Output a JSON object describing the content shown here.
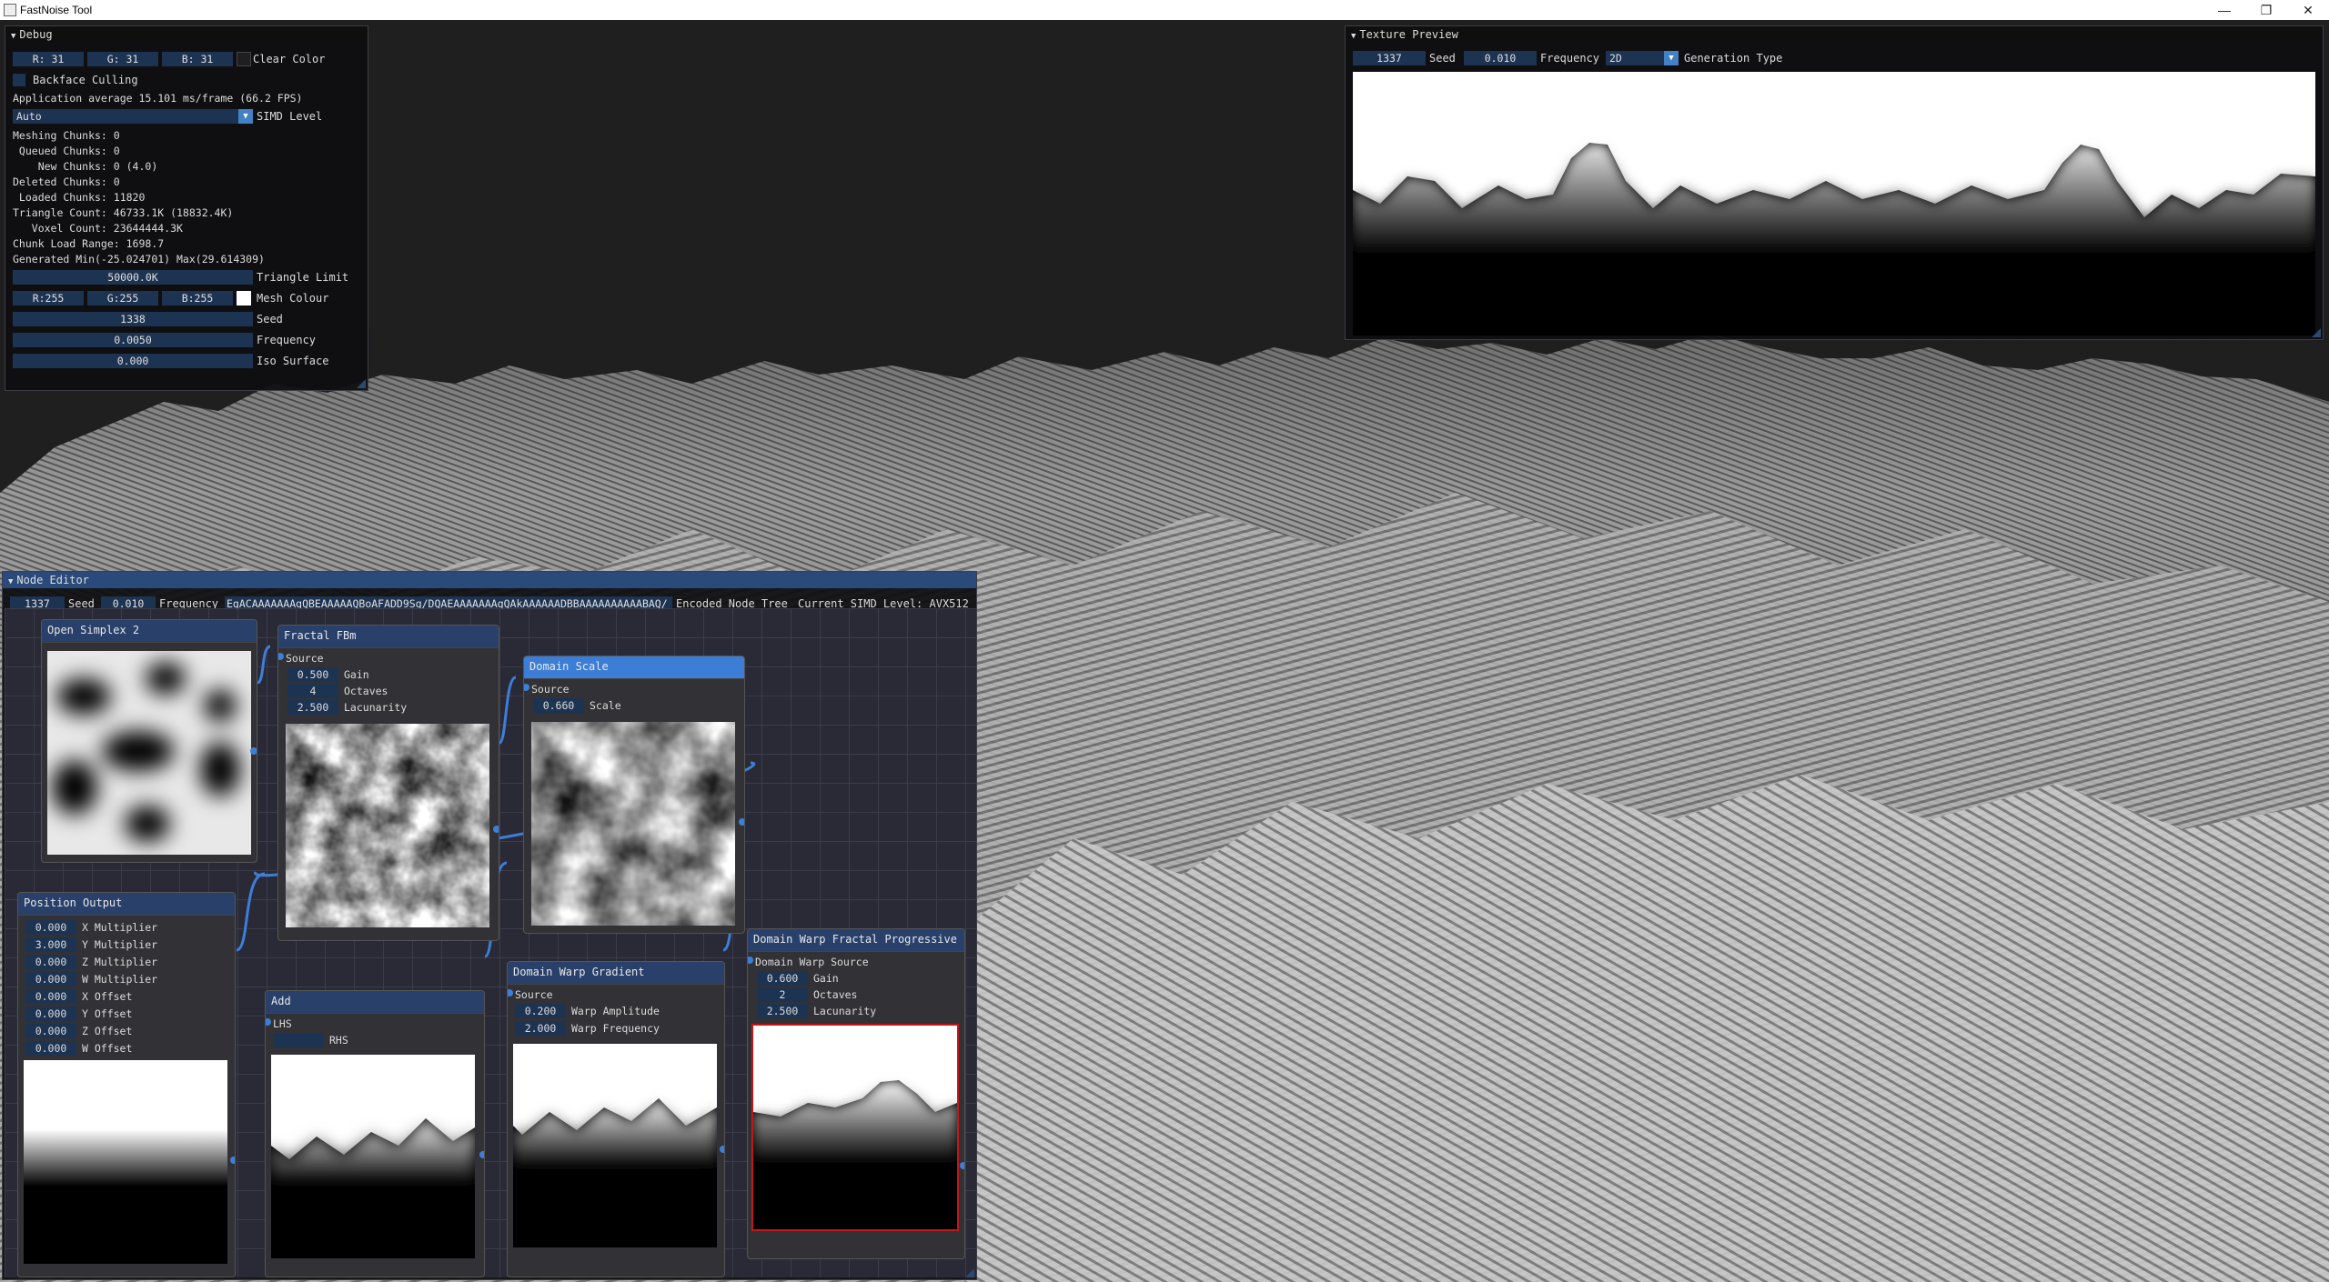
{
  "window": {
    "title": "FastNoise Tool"
  },
  "debug": {
    "title": "Debug",
    "clear_color": {
      "r": "R: 31",
      "g": "G: 31",
      "b": "B: 31",
      "label": "Clear Color"
    },
    "backface_label": "Backface Culling",
    "app_average": "Application average 15.101 ms/frame (66.2 FPS)",
    "simd_value": "Auto",
    "simd_label": "SIMD Level",
    "stats": [
      "Meshing Chunks: 0",
      " Queued Chunks: 0",
      "    New Chunks: 0 (4.0)",
      "Deleted Chunks: 0",
      " Loaded Chunks: 11820",
      "Triangle Count: 46733.1K (18832.4K)",
      "   Voxel Count: 23644444.3K",
      "Chunk Load Range: 1698.7",
      "Generated Min(-25.024701) Max(29.614309)"
    ],
    "triangle_limit_value": "50000.0K",
    "triangle_limit_label": "Triangle Limit",
    "mesh_colour": {
      "r": "R:255",
      "g": "G:255",
      "b": "B:255",
      "label": "Mesh Colour"
    },
    "seed_value": "1338",
    "seed_label": "Seed",
    "frequency_value": "0.0050",
    "frequency_label": "Frequency",
    "iso_value": "0.000",
    "iso_label": "Iso Surface"
  },
  "texture_preview": {
    "title": "Texture Preview",
    "seed_value": "1337",
    "seed_label": "Seed",
    "frequency_value": "0.010",
    "frequency_label": "Frequency",
    "gen_type_value": "2D",
    "gen_type_label": "Generation Type"
  },
  "node_editor": {
    "title": "Node Editor",
    "seed_value": "1337",
    "seed_label": "Seed",
    "frequency_value": "0.010",
    "frequency_label": "Frequency",
    "encoded_value": "EgACAAAAAAAgQBEAAAAAQBoAFADD9Sg/DQAEAAAAAAAgQAkAAAAAADBBAAAAAAAAAABAQ/",
    "encoded_label": "Encoded Node Tree",
    "simd_level": "Current SIMD Level: AVX512",
    "nodes": {
      "open_simplex": {
        "title": "Open Simplex 2"
      },
      "fractal_fbm": {
        "title": "Fractal FBm",
        "source": "Source",
        "gain_value": "0.500",
        "gain_label": "Gain",
        "octaves_value": "4",
        "octaves_label": "Octaves",
        "lacunarity_value": "2.500",
        "lacunarity_label": "Lacunarity"
      },
      "domain_scale": {
        "title": "Domain Scale",
        "source": "Source",
        "scale_value": "0.660",
        "scale_label": "Scale"
      },
      "position_output": {
        "title": "Position Output",
        "rows": [
          {
            "value": "0.000",
            "label": "X Multiplier"
          },
          {
            "value": "3.000",
            "label": "Y Multiplier"
          },
          {
            "value": "0.000",
            "label": "Z Multiplier"
          },
          {
            "value": "0.000",
            "label": "W Multiplier"
          },
          {
            "value": "0.000",
            "label": "X Offset"
          },
          {
            "value": "0.000",
            "label": "Y Offset"
          },
          {
            "value": "0.000",
            "label": "Z Offset"
          },
          {
            "value": "0.000",
            "label": "W Offset"
          }
        ]
      },
      "add": {
        "title": "Add",
        "lhs": "LHS",
        "rhs": "RHS"
      },
      "domain_warp_gradient": {
        "title": "Domain Warp Gradient",
        "source": "Source",
        "amp_value": "0.200",
        "amp_label": "Warp Amplitude",
        "freq_value": "2.000",
        "freq_label": "Warp Frequency"
      },
      "domain_warp_fractal": {
        "title": "Domain Warp Fractal Progressive",
        "source": "Domain Warp Source",
        "gain_value": "0.600",
        "gain_label": "Gain",
        "octaves_value": "2",
        "octaves_label": "Octaves",
        "lacunarity_value": "2.500",
        "lacunarity_label": "Lacunarity"
      }
    }
  },
  "colors": {
    "accent": "#4281c4",
    "field_bg": "#1d3352",
    "node_title": "#28406a",
    "node_selected": "#3c7dd6",
    "link": "#3c7fd8"
  },
  "icons": [
    "collapse-triangle-icon",
    "minimize-icon",
    "restore-icon",
    "close-icon",
    "combo-arrow-icon"
  ]
}
